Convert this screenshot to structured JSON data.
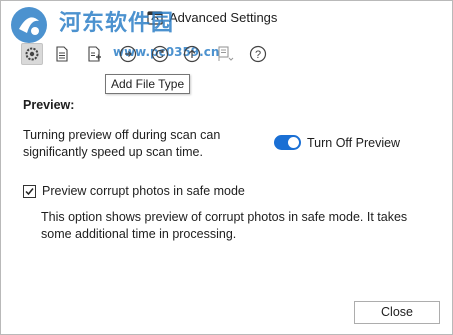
{
  "window": {
    "title": "Advanced Settings"
  },
  "watermark": {
    "site_name": "河东软件园",
    "url": "www.pc0359.cn"
  },
  "toolbar": {
    "buttons": [
      {
        "icon": "settings-gear-icon",
        "active": true
      },
      {
        "icon": "document-icon"
      },
      {
        "icon": "add-file-type-icon"
      },
      {
        "icon": "circle-arrow-icon"
      },
      {
        "icon": "refresh-circle-icon"
      },
      {
        "icon": "upload-circle-icon"
      },
      {
        "icon": "flag-dropdown-icon"
      },
      {
        "icon": "help-icon"
      }
    ],
    "tooltip": "Add File Type"
  },
  "preview": {
    "heading": "Preview:",
    "description": "Turning preview off during scan can significantly speed up scan time.",
    "toggle_label": "Turn Off Preview",
    "toggle_on": true,
    "checkbox_label": "Preview corrupt photos in safe mode",
    "checkbox_checked": true,
    "help_text": "This option shows preview of corrupt photos in safe mode. It takes some additional time in processing."
  },
  "footer": {
    "close_label": "Close"
  },
  "colors": {
    "accent": "#1a6fd4",
    "watermark": "#2d7fc7"
  }
}
